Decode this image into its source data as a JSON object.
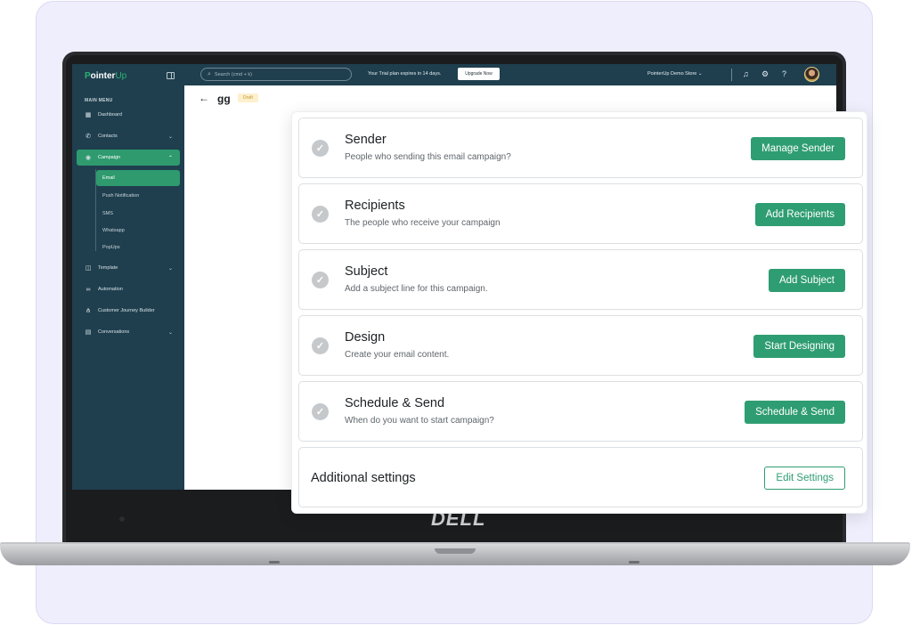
{
  "brand_logo": "DELL",
  "app": {
    "logo_prefix": "P",
    "logo_main": "ointer",
    "logo_suffix": "Up"
  },
  "sidebar": {
    "menu_heading": "MAIN MENU",
    "items": [
      {
        "label": "Dashboard",
        "icon": "grid-icon"
      },
      {
        "label": "Contacts",
        "icon": "phone-icon"
      },
      {
        "label": "Campaign",
        "icon": "campaign-icon"
      },
      {
        "label": "Template",
        "icon": "template-icon"
      },
      {
        "label": "Automation",
        "icon": "automation-icon"
      },
      {
        "label": "Customer Journey Builder",
        "icon": "journey-icon"
      },
      {
        "label": "Conversations",
        "icon": "chat-icon"
      }
    ],
    "campaign_sub": [
      "Email",
      "Push Notification",
      "SMS",
      "Whatsapp",
      "PopUps"
    ]
  },
  "topbar": {
    "search_placeholder": "Search (cmd + k)",
    "trial_text": "Your Trial plan expires in 14 days.",
    "upgrade_label": "Upgrade Now",
    "store_name": "PointerUp Demo Store"
  },
  "page": {
    "title": "gg",
    "status": "Draft"
  },
  "steps": [
    {
      "title": "Sender",
      "desc": "People who sending this email campaign?",
      "button": "Manage Sender"
    },
    {
      "title": "Recipients",
      "desc": "The people who receive your campaign",
      "button": "Add Recipients"
    },
    {
      "title": "Subject",
      "desc": "Add a subject line for this campaign.",
      "button": "Add Subject"
    },
    {
      "title": "Design",
      "desc": "Create your email content.",
      "button": "Start Designing"
    },
    {
      "title": "Schedule & Send",
      "desc": "When do you want to start campaign?",
      "button": "Schedule & Send"
    }
  ],
  "additional": {
    "title": "Additional settings",
    "button": "Edit Settings"
  },
  "colors": {
    "sidebar": "#1f3f4f",
    "accent": "#2f9d72",
    "draft_badge": "#fdf0cc"
  }
}
